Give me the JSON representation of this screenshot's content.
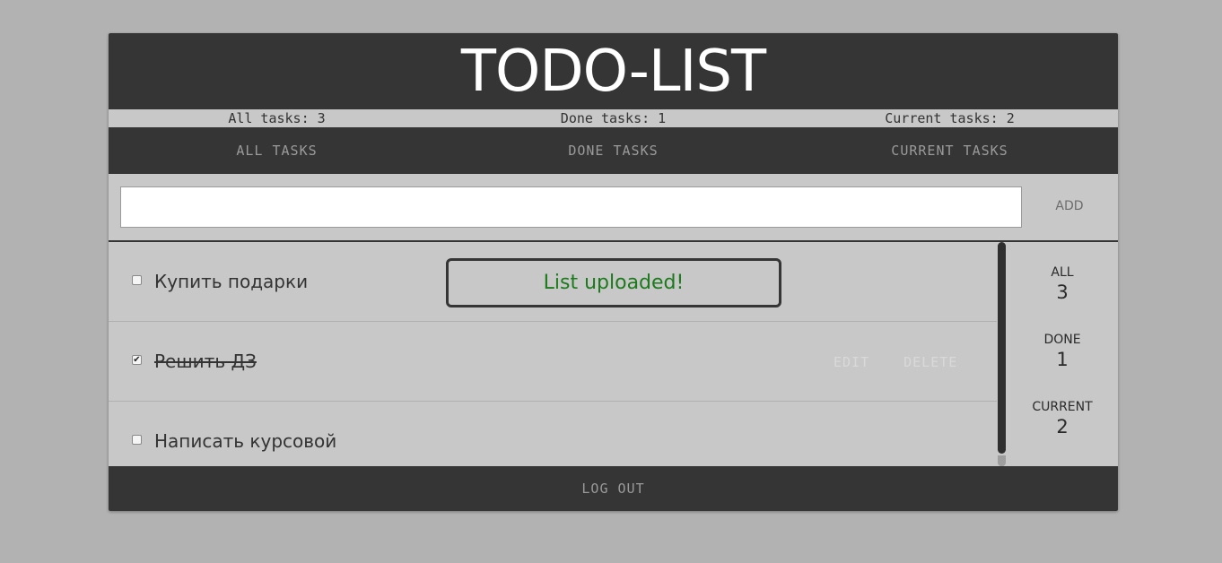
{
  "header": {
    "title": "TODO-LIST"
  },
  "stats": {
    "all": "All tasks: 3",
    "done": "Done tasks: 1",
    "current": "Current tasks: 2"
  },
  "filters": {
    "all": "ALL TASKS",
    "done": "DONE TASKS",
    "current": "CURRENT TASKS"
  },
  "add": {
    "input_value": "",
    "button_label": "ADD"
  },
  "tasks": [
    {
      "title": "Купить подарки",
      "done": false
    },
    {
      "title": "Решить ДЗ",
      "done": true,
      "edit_label": "EDIT",
      "delete_label": "DELETE"
    },
    {
      "title": "Написать курсовой",
      "done": false
    }
  ],
  "toast": {
    "message": "List uploaded!"
  },
  "counters": {
    "all_label": "ALL",
    "all_value": "3",
    "done_label": "DONE",
    "done_value": "1",
    "current_label": "CURRENT",
    "current_value": "2"
  },
  "footer": {
    "logout_label": "LOG OUT"
  },
  "colors": {
    "background": "#b2b2b2",
    "dark_bar": "#353535",
    "panel": "#c8c8c8",
    "toast_text": "#1c7a1c"
  }
}
